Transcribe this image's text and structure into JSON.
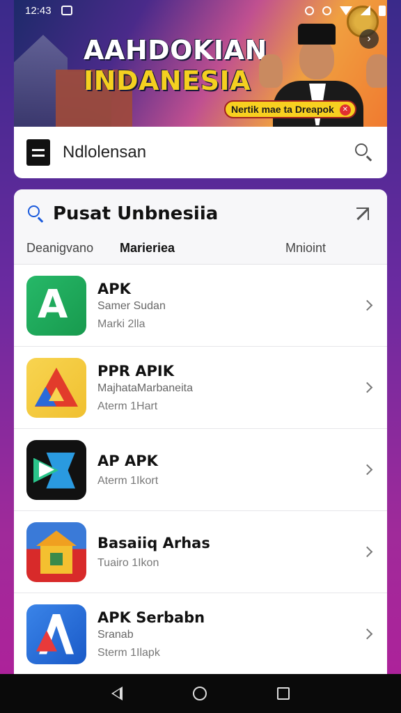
{
  "status_bar": {
    "time": "12:43"
  },
  "banner": {
    "title_line1": "AAHDOKIAN",
    "title_line2": "INDANESIA",
    "pill_text": "Nertik mae ta Dreapok",
    "colors": {
      "title": "#ffffff",
      "title_accent": "#f4d020",
      "pill_bg": "#f8d020"
    }
  },
  "search_bar": {
    "value": "Ndlolensan"
  },
  "main": {
    "title": "Pusat Unbnesiia",
    "tabs": [
      {
        "label": "Deanigvano",
        "active": false
      },
      {
        "label": "Marieriea",
        "active": true
      },
      {
        "label": "Mnioint",
        "active": false
      }
    ],
    "apps": [
      {
        "name": "APK",
        "subtitle": "Samer Sudan",
        "meta": "Marki 2lla",
        "icon": "green-apk-icon"
      },
      {
        "name": "PPR APIK",
        "subtitle": "MajhataMarbaneita",
        "meta": "Aterm 1Hart",
        "icon": "triangle-apk-icon"
      },
      {
        "name": "AP APK",
        "subtitle": "",
        "meta": "Aterm 1Ikort",
        "icon": "dark-x-apk-icon"
      },
      {
        "name": "Basaiiq Arhas",
        "subtitle": "",
        "meta": "Tuairo 1Ikon",
        "icon": "house-apk-icon"
      },
      {
        "name": "APK Serbabn",
        "subtitle": "Sranab",
        "meta": "Sterm 1Ilapk",
        "icon": "blue-a-apk-icon"
      }
    ]
  },
  "theme": {
    "accent": "#1a5adc",
    "background_start": "#3a2a8a",
    "background_end": "#b0209a"
  }
}
